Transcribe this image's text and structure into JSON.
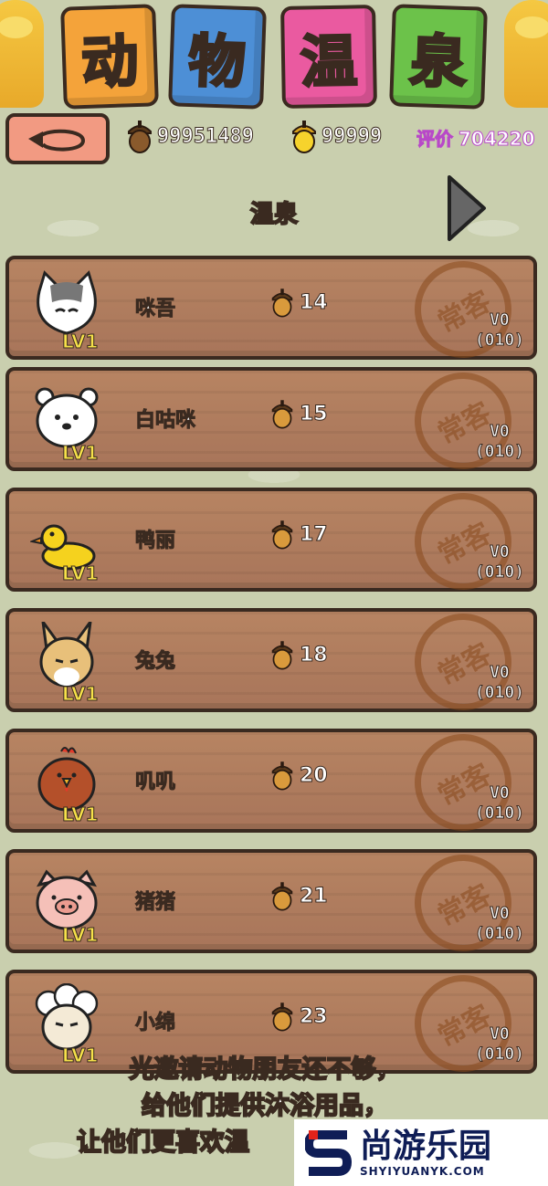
{
  "title": {
    "tiles": [
      "动",
      "物",
      "温",
      "泉"
    ]
  },
  "stats": {
    "acorns": "99951489",
    "golden_acorns": "99999",
    "rating_label": "评价",
    "rating_value": "704220"
  },
  "section_title": "温泉",
  "animals": [
    {
      "name": "咪吾",
      "level": "LV1",
      "price": "14",
      "stamp": "常客",
      "vip_line1": "V0",
      "vip_line2": "(010)"
    },
    {
      "name": "白咕咪",
      "level": "LV1",
      "price": "15",
      "stamp": "常客",
      "vip_line1": "V0",
      "vip_line2": "(010)"
    },
    {
      "name": "鸭丽",
      "level": "LV1",
      "price": "17",
      "stamp": "常客",
      "vip_line1": "V0",
      "vip_line2": "(010)"
    },
    {
      "name": "兔兔",
      "level": "LV1",
      "price": "18",
      "stamp": "常客",
      "vip_line1": "V0",
      "vip_line2": "(010)"
    },
    {
      "name": "叽叽",
      "level": "LV1",
      "price": "20",
      "stamp": "常客",
      "vip_line1": "V0",
      "vip_line2": "(010)"
    },
    {
      "name": "猪猪",
      "level": "LV1",
      "price": "21",
      "stamp": "常客",
      "vip_line1": "V0",
      "vip_line2": "(010)"
    },
    {
      "name": "小绵",
      "level": "LV1",
      "price": "23",
      "stamp": "常客",
      "vip_line1": "V0",
      "vip_line2": "(010)"
    }
  ],
  "promo": {
    "line1": "光邀请动物朋友还不够，",
    "line2": "给他们提供沐浴用品，",
    "line3": "让他们更喜欢温"
  },
  "watermark": {
    "cn": "尚游乐园",
    "en": "SHYIYUANYK.COM"
  },
  "icons": {
    "back": "back-arrow-icon",
    "acorn": "acorn-icon",
    "golden_acorn": "golden-acorn-icon",
    "next": "next-arrow-icon"
  }
}
